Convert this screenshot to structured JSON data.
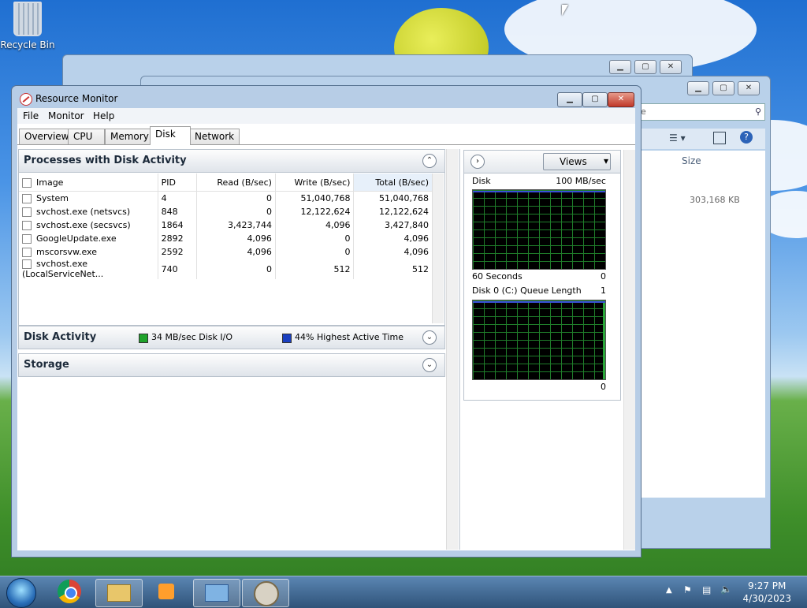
{
  "desktop": {
    "recycle_bin_label": "Recycle Bin"
  },
  "background_window": {
    "search_placeholder": "ore",
    "column_size": "Size",
    "file_size": "303,168 KB"
  },
  "window": {
    "title": "Resource Monitor",
    "minimize": "▁",
    "maximize": "▢",
    "close": "✕"
  },
  "menu": {
    "file": "File",
    "monitor": "Monitor",
    "help": "Help"
  },
  "tabs": {
    "overview": "Overview",
    "cpu": "CPU",
    "memory": "Memory",
    "disk": "Disk",
    "network": "Network"
  },
  "processes": {
    "title": "Processes with Disk Activity",
    "headers": {
      "image": "Image",
      "pid": "PID",
      "read": "Read (B/sec)",
      "write": "Write (B/sec)",
      "total": "Total (B/sec)"
    },
    "rows": [
      {
        "image": "System",
        "pid": "4",
        "read": "0",
        "write": "51,040,768",
        "total": "51,040,768"
      },
      {
        "image": "svchost.exe (netsvcs)",
        "pid": "848",
        "read": "0",
        "write": "12,122,624",
        "total": "12,122,624"
      },
      {
        "image": "svchost.exe (secsvcs)",
        "pid": "1864",
        "read": "3,423,744",
        "write": "4,096",
        "total": "3,427,840"
      },
      {
        "image": "GoogleUpdate.exe",
        "pid": "2892",
        "read": "4,096",
        "write": "0",
        "total": "4,096"
      },
      {
        "image": "mscorsvw.exe",
        "pid": "2592",
        "read": "4,096",
        "write": "0",
        "total": "4,096"
      },
      {
        "image": "svchost.exe (LocalServiceNet...",
        "pid": "740",
        "read": "0",
        "write": "512",
        "total": "512"
      }
    ]
  },
  "disk_activity": {
    "title": "Disk Activity",
    "io": "34 MB/sec Disk I/O",
    "active": "44% Highest Active Time",
    "io_color": "#1fa32b",
    "active_color": "#1a3fc0"
  },
  "storage": {
    "title": "Storage"
  },
  "graphs": {
    "views_label": "Views",
    "disk_title": "Disk",
    "disk_max": "100 MB/sec",
    "disk_footer_left": "60 Seconds",
    "disk_footer_right": "0",
    "queue_title": "Disk 0 (C:) Queue Length",
    "queue_max": "1",
    "queue_footer_right": "0"
  },
  "taskbar": {
    "time": "9:27 PM",
    "date": "4/30/2023"
  }
}
